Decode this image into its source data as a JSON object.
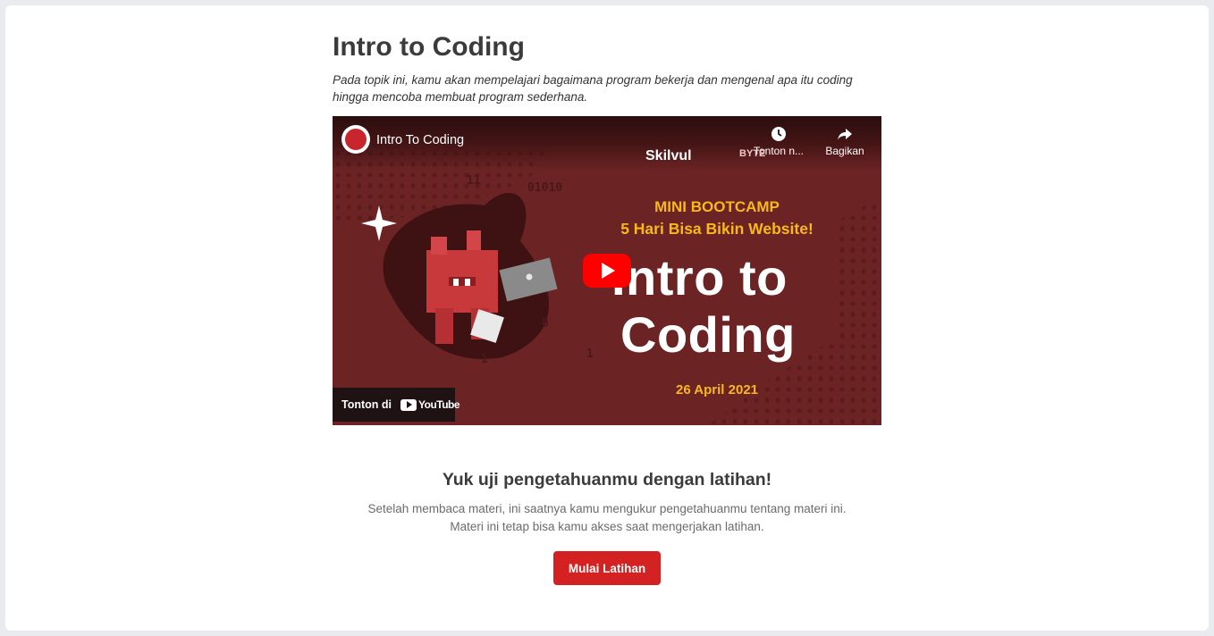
{
  "lesson": {
    "title": "Intro to Coding",
    "description": "Pada topik ini, kamu akan mempelajari bagaimana program bekerja dan mengenal apa itu coding hingga mencoba membuat program sederhana."
  },
  "video": {
    "title": "Intro To Coding",
    "watch_later_label": "Tonton n...",
    "share_label": "Bagikan",
    "brand_label": "Skilvul",
    "brand_partner_label": "BYTE",
    "banner_line1": "MINI BOOTCAMP",
    "banner_line2": "5 Hari Bisa Bikin Website!",
    "headline_line1": "Intro to",
    "headline_line2": "Coding",
    "date": "26 April 2021",
    "watch_on_label": "Tonton di",
    "youtube_label": "YouTube",
    "binary_text": [
      "11",
      "01010",
      "0",
      "1",
      "1"
    ],
    "colors": {
      "background": "#6b2324",
      "accent": "#f7b81c",
      "play": "#ff0000"
    }
  },
  "exercise": {
    "title": "Yuk uji pengetahuanmu dengan latihan!",
    "description": "Setelah membaca materi, ini saatnya kamu mengukur pengetahuanmu tentang materi ini. Materi ini tetap bisa kamu akses saat mengerjakan latihan.",
    "button_label": "Mulai Latihan",
    "button_color": "#d42121"
  },
  "icons": [
    "clock-icon",
    "share-icon",
    "play-icon",
    "youtube-logo-icon",
    "sparkle-icon",
    "mascot-icon",
    "channel-avatar-icon"
  ]
}
